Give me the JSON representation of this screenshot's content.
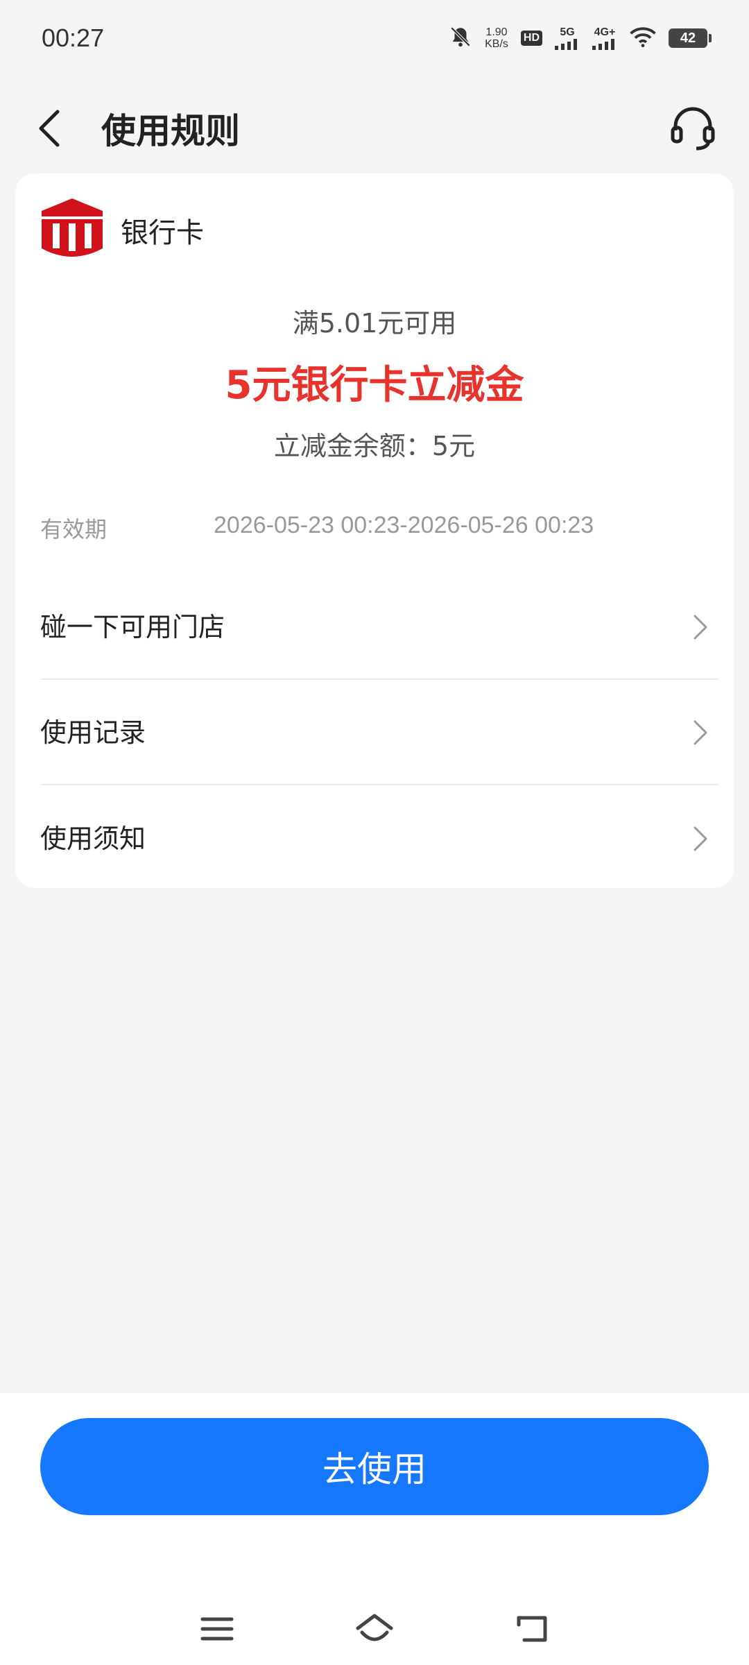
{
  "status_bar": {
    "time": "00:27",
    "net_speed_value": "1.90",
    "net_speed_unit": "KB/s",
    "hd_label": "HD",
    "sim1_label": "5G",
    "sim2_label": "4G+",
    "battery": "42"
  },
  "header": {
    "title": "使用规则"
  },
  "card": {
    "bank_name": "银行卡",
    "threshold_text": "满5.01元可用",
    "coupon_title": "5元银行卡立减金",
    "balance_text": "立减金余额：5元",
    "validity_label": "有效期",
    "validity_value": "2026-05-23 00:23-2026-05-26 00:23",
    "menu": [
      {
        "label": "碰一下可用门店"
      },
      {
        "label": "使用记录"
      },
      {
        "label": "使用须知"
      }
    ]
  },
  "cta": {
    "label": "去使用"
  },
  "colors": {
    "accent": "#1677ff",
    "coupon_red": "#e8332c",
    "logo_red": "#d0121b"
  }
}
